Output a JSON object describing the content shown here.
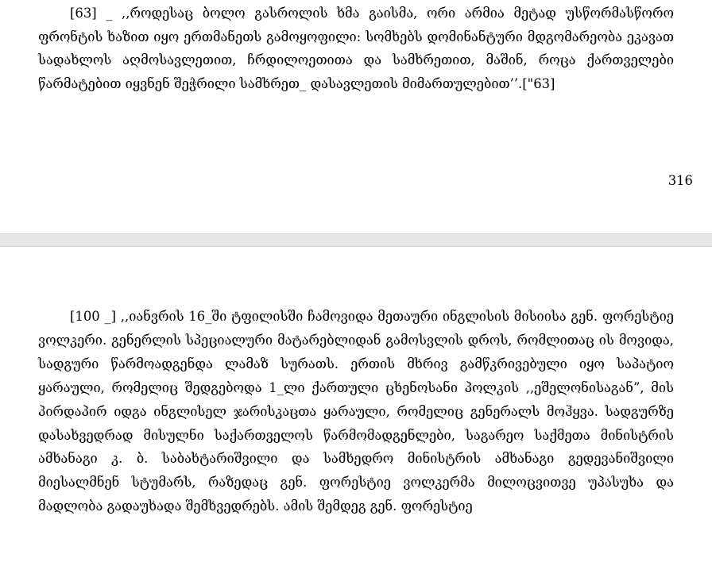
{
  "top_page": {
    "paragraph": "[63] _ ,,როდესაც ბოლო გასროლის ხმა გაისმა, ორი არმია მეტად უსწორმასწორო ფრონტის ხაზით იყო ერთმანეთს გამოყოფილი: სომხებს დომინანტური მდგომარეობა ეკავათ სადახლოს აღმოსავლეთით, ჩრდილოეთითა და სამხრეთით, მაშინ, როცა ქართველები წარმატებით იყვნენ შეჭრილი სამხრეთ_ დასავლეთის მიმართულებით’’.[\"63]",
    "page_number": "316"
  },
  "bottom_page": {
    "paragraph": "[100 _] ,,იანვრის 16_ში ტფილისში ჩამოვიდა მეთაური ინგლისის მისიისა გენ. ფორესტიე ვოლკერი. გენერლის სპეციალური მატარებლიდან გამოსვლის დროს, რომლითაც ის მოვიდა, სადგური წარმოადგენდა ლამაზ სურათს. ერთის მხრივ გამწკრივებული იყო საპატიო ყარაული, რომელიც შედგებოდა 1_ლი ქართული ცხენოსანი პოლკის ,,ეშელონისაგან”, მის პირდაპირ იდგა ინგლისელ ჯარისკაცთა ყარაული, რომელიც გენერალს მოჰყვა. სადგურზე დასახვედრად მისულნი საქართველოს წარმომადგენლები, საგარეო საქმეთა მინისტრის ამხანაგი კ. ბ. საბახტარიშვილი და სამხედრო მინისტრის ამხანაგი გედევანიშვილი მიესალმნენ სტუმარს, რაზედაც გენ. ფორესტიე ვოლკერმა მილოცვითვე უპასუხა და მადლობა გადაუხადა შემხვედრებს. ამის შემდეგ გენ. ფორესტიე"
  }
}
